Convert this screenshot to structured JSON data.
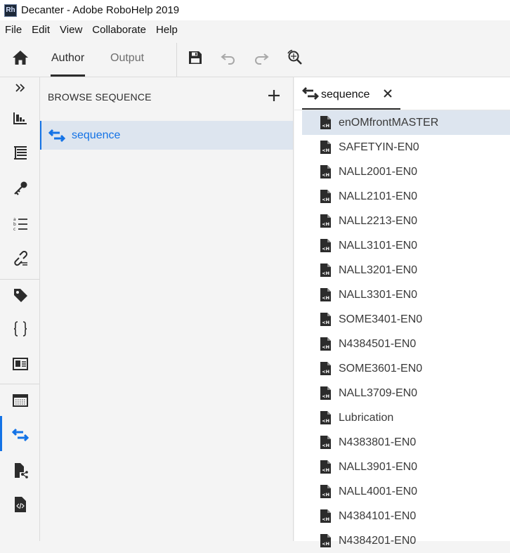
{
  "window": {
    "title": "Decanter - Adobe RoboHelp 2019",
    "app_icon_text": "Rh"
  },
  "menu": [
    "File",
    "Edit",
    "View",
    "Collaborate",
    "Help"
  ],
  "toolbar": {
    "tabs": [
      "Author",
      "Output"
    ],
    "active_tab": "Author",
    "icons": [
      "home-icon",
      "save-icon",
      "undo-icon",
      "redo-icon",
      "search-icon"
    ]
  },
  "leftrail": {
    "icons": [
      "expand-icon",
      "contents-icon",
      "toc-icon",
      "key-icon",
      "list-icon",
      "link-icon",
      "tag-icon",
      "braces-icon",
      "image-card-icon",
      "window-icon",
      "browse-sequence-icon",
      "doc-share-icon",
      "code-doc-icon"
    ],
    "active": "browse-sequence-icon"
  },
  "browse_panel": {
    "title": "BROWSE SEQUENCE",
    "items": [
      "sequence"
    ]
  },
  "sequence_panel": {
    "tab_label": "sequence",
    "topics": [
      "enOMfrontMASTER",
      "SAFETYIN-EN0",
      "NALL2001-EN0",
      "NALL2101-EN0",
      "NALL2213-EN0",
      "NALL3101-EN0",
      "NALL3201-EN0",
      "NALL3301-EN0",
      "SOME3401-EN0",
      "N4384501-EN0",
      "SOME3601-EN0",
      "NALL3709-EN0",
      "Lubrication",
      "N4383801-EN0",
      "NALL3901-EN0",
      "NALL4001-EN0",
      "N4384101-EN0",
      "N4384201-EN0"
    ],
    "selected_index": 0
  },
  "colors": {
    "accent": "#1473e6",
    "selection": "#dde5ef"
  }
}
